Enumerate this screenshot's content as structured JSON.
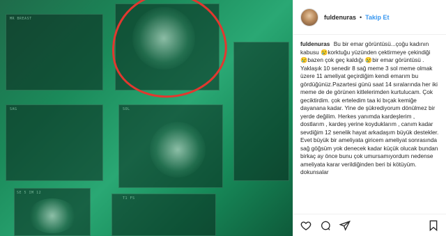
{
  "header": {
    "username": "fuldenuras",
    "separator": "•",
    "follow_label": "Takip Et"
  },
  "caption": {
    "username": "fuldenuras",
    "text": "Bu bir emar görüntüsü...çoğu kadının kabusu 😢korktuğu yüzünden çektirmeye çekindiği 😢bazen çok geç kaldığı 😢bir emar görüntüsü . Yaklaşık 10 senedir 8 sağ meme 3 sol meme olmak üzere 11 ameliyat geçirdiğim kendi emarım bu gördüğünüz.Pazartesi günü saat 14 sıralarında her iki meme de de görünen kitlelerimden kurtulucam. Çok geciktirdim. çok erteledim taa ki bıçak kemiğe dayanana kadar. Yine de şükrediyorum dönülmez bir yerde değilim. Herkes yanımda kardeşlerim , dostlarım , kardeş yerine koyduklarım , canım kadar sevdiğim 12 senelik hayat arkadaşım büyük destekler. Evet büyük bir ameliyata giricem ameliyat sonrasında sağ göğsüm yok denecek kadar küçük olucak bundan birkaç ay önce bunu çok umursamıyordum nedense ameliyata karar verildiğinden beri bi kötüyüm. dokunsalar"
  },
  "media": {
    "film_labels": [
      "MR BREAST",
      "SAG",
      "SOL",
      "T1 FS",
      "SE 5 IM 12"
    ]
  },
  "icons": {
    "like": "heart-icon",
    "comment": "comment-icon",
    "share": "share-icon",
    "save": "bookmark-icon"
  },
  "colors": {
    "follow": "#3897f0",
    "highlight_circle": "#e2382f",
    "scan_green": "#1b8a5a"
  }
}
